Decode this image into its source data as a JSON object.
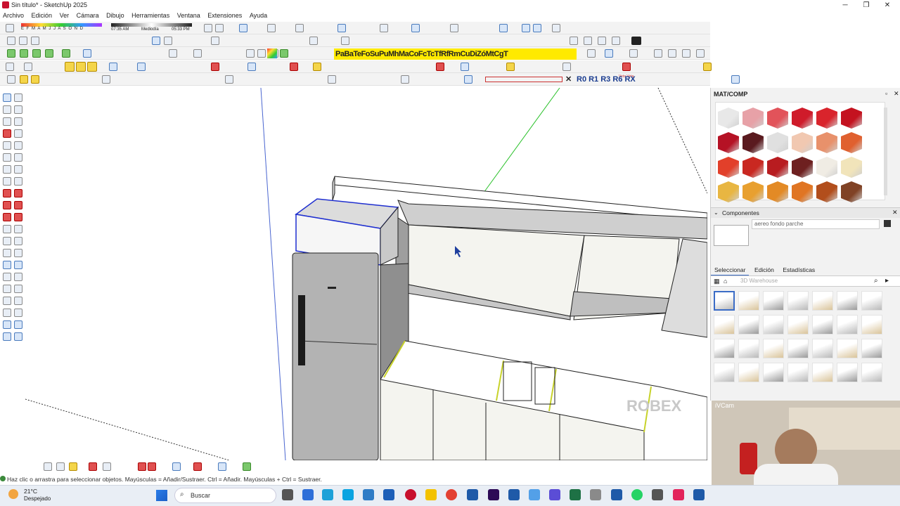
{
  "window": {
    "title": "Sin título* - SketchUp 2025",
    "minimize": "─",
    "maximize": "❐",
    "close": "✕"
  },
  "menu": [
    "Archivo",
    "Edición",
    "Ver",
    "Cámara",
    "Dibujo",
    "Herramientas",
    "Ventana",
    "Extensiones",
    "Ayuda"
  ],
  "shadow_bar": {
    "months": "E F M A M J J A S O N D",
    "time_start": "07:35 AM",
    "noon": "Mediodía",
    "time_end": "05:33 PM"
  },
  "yellow_toolbar": {
    "labels": "PaBaTeFoSuPuMhMaCoFcTcTfRfRmCuDiZóMtCgT"
  },
  "rotate_toolbar": {
    "labels": "R0 R1 R3 R6 RX"
  },
  "veta_label": "Veta Veta",
  "panel": {
    "title": "MAT/COMP",
    "components_header": "Componentes",
    "component_name": "aereo fondo parche",
    "tabs": [
      "Seleccionar",
      "Edición",
      "Estadísticas"
    ],
    "search_placeholder": "3D Warehouse",
    "swatch_colors": [
      "#e8e8e8",
      "#e7a1a7",
      "#e2535a",
      "#cf1b2a",
      "#d9242c",
      "#c4121f",
      "#b51225",
      "#5a1a1f",
      "#e0e0e0",
      "#f1c8b1",
      "#e8916b",
      "#e0602f",
      "#e2402a",
      "#c92821",
      "#b81c20",
      "#6e2020",
      "#f0ece4",
      "#f1e4ba",
      "#e8b642",
      "#e8a030",
      "#e38a25",
      "#e07523",
      "#b24e1c",
      "#804225"
    ]
  },
  "watermark": "ROBEX",
  "status": {
    "hint": "Haz clic o arrastra para seleccionar objetos. Mayúsculas = Añadir/Sustraer. Ctrl = Añadir. Mayúsculas + Ctrl = Sustraer."
  },
  "taskbar": {
    "weather_temp": "21°C",
    "weather_text": "Despejado",
    "search_label": "Buscar"
  },
  "webcam_label": "iVCam"
}
